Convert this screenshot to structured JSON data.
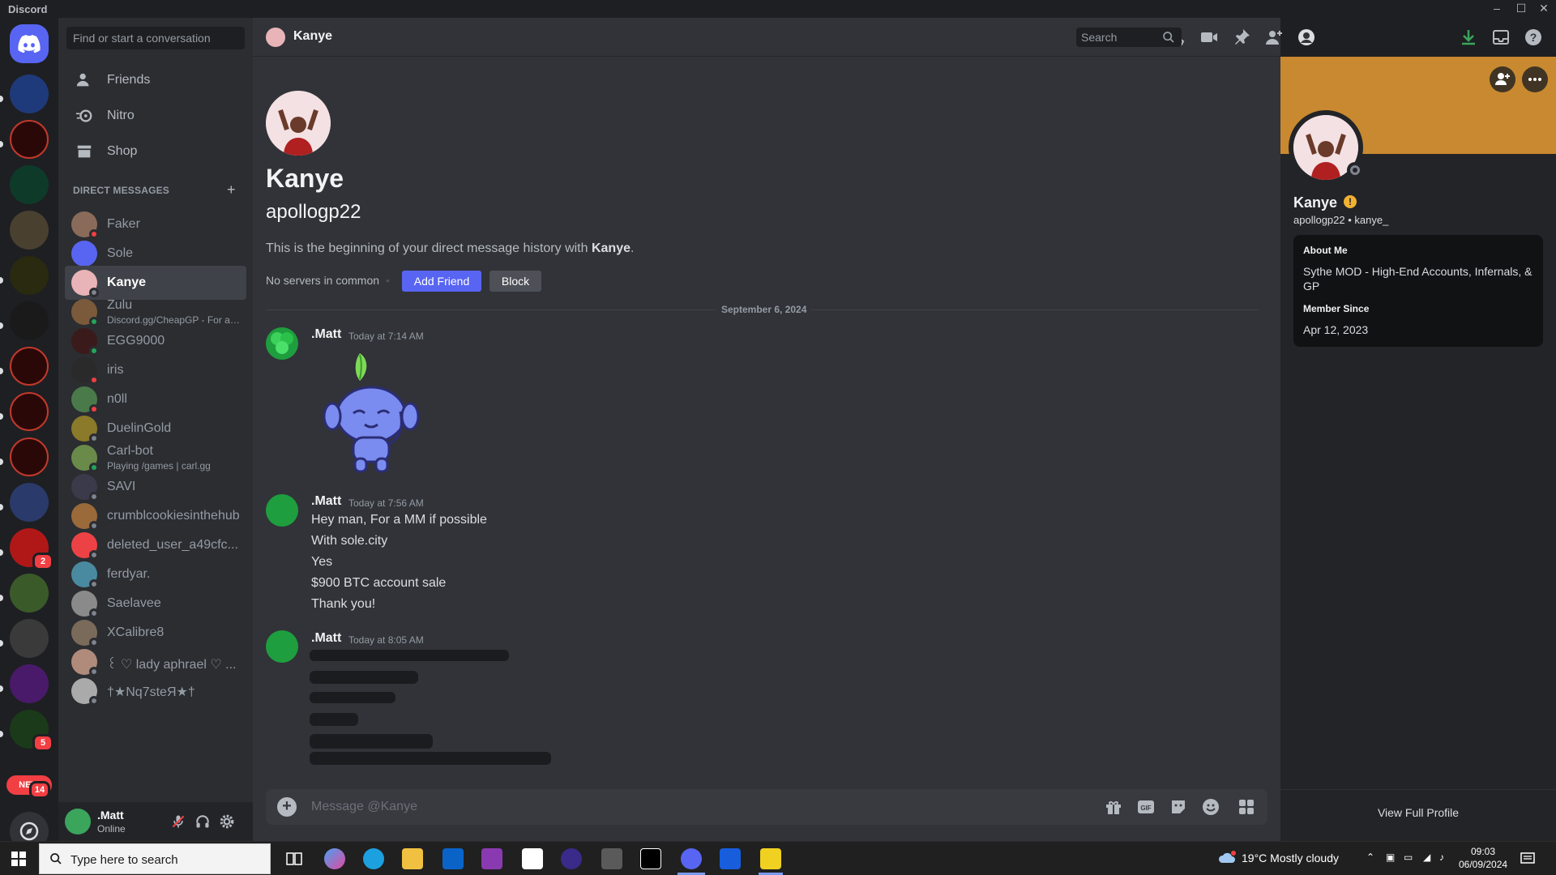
{
  "window": {
    "app_name": "Discord",
    "controls": [
      "–",
      "☐",
      "✕"
    ]
  },
  "search_placeholder": "Find or start a conversation",
  "nav": [
    {
      "label": "Friends",
      "icon": "friends-icon"
    },
    {
      "label": "Nitro",
      "icon": "nitro-icon"
    },
    {
      "label": "Shop",
      "icon": "shop-icon"
    }
  ],
  "dm_header": "DIRECT MESSAGES",
  "dm_add": "+",
  "dms": [
    {
      "name": "Faker",
      "sub": "",
      "status": "dnd",
      "color": "#8a6b5a"
    },
    {
      "name": "Sole",
      "sub": "",
      "status": "none",
      "color": "#5865f2"
    },
    {
      "name": "Kanye",
      "sub": "",
      "status": "offline",
      "color": "#e8b4b8",
      "selected": true
    },
    {
      "name": "Zulu",
      "sub": "Discord.gg/CheapGP - For all ...",
      "status": "online",
      "color": "#7a5a3a"
    },
    {
      "name": "EGG9000",
      "sub": "",
      "status": "online",
      "color": "#3a1a1a"
    },
    {
      "name": "iris",
      "sub": "",
      "status": "dnd",
      "color": "#2a2a2a"
    },
    {
      "name": "n0ll",
      "sub": "",
      "status": "dnd",
      "color": "#4a7a4a"
    },
    {
      "name": "DuelinGold",
      "sub": "",
      "status": "offline",
      "color": "#8a7a2a"
    },
    {
      "name": "Carl-bot",
      "sub": "Playing /games | carl.gg",
      "status": "online",
      "color": "#6a8a4a"
    },
    {
      "name": "SAVI",
      "sub": "",
      "status": "offline",
      "color": "#3a3a4a"
    },
    {
      "name": "crumblcookiesinthehub",
      "sub": "",
      "status": "offline",
      "color": "#9a6a3a"
    },
    {
      "name": "deleted_user_a49cfc...",
      "sub": "",
      "status": "offline",
      "color": "#ed4245"
    },
    {
      "name": "ferdyar.",
      "sub": "",
      "status": "offline",
      "color": "#4a8aa0"
    },
    {
      "name": "Saelavee",
      "sub": "",
      "status": "offline",
      "color": "#8a8a8a"
    },
    {
      "name": "XCalibre8",
      "sub": "",
      "status": "offline",
      "color": "#7a6a5a"
    },
    {
      "name": "꒰ ♡ lady aphrael ♡ ...",
      "sub": "",
      "status": "offline",
      "color": "#b08a7a"
    },
    {
      "name": "†★Nq7steЯ★†",
      "sub": "",
      "status": "offline",
      "color": "#aaaaaa"
    }
  ],
  "user": {
    "name": ".Matt",
    "status": "Online"
  },
  "chat": {
    "recipient": "Kanye",
    "header_search": "Search",
    "intro_name": "Kanye",
    "intro_username": "apollogp22",
    "intro_text_prefix": "This is the beginning of your direct message history with ",
    "intro_text_name": "Kanye",
    "intro_text_suffix": ".",
    "no_servers": "No servers in common",
    "add_friend": "Add Friend",
    "block": "Block",
    "date_divider": "September 6, 2024",
    "messages": [
      {
        "author": ".Matt",
        "time": "Today at 7:14 AM",
        "lines": []
      },
      {
        "author": ".Matt",
        "time": "Today at 7:56 AM",
        "lines": [
          "Hey man, For a MM if possible",
          "With sole.city",
          "Yes",
          "$900 BTC account sale",
          "Thank you!"
        ]
      },
      {
        "author": ".Matt",
        "time": "Today at 8:05 AM",
        "lines": []
      }
    ],
    "composer_placeholder": "Message @Kanye"
  },
  "profile": {
    "name": "Kanye",
    "username": "apollogp22",
    "alt": "kanye_",
    "about_label": "About Me",
    "about": "Sythe MOD - High-End Accounts, Infernals, & GP",
    "member_label": "Member Since",
    "member_since": "Apr 12, 2023",
    "view_full": "View Full Profile",
    "banner_color": "#c88930"
  },
  "taskbar": {
    "search_placeholder": "Type here to search",
    "weather": "19°C  Mostly cloudy",
    "time": "09:03",
    "date": "06/09/2024"
  },
  "server_badges": [
    "2",
    "5",
    "14"
  ],
  "new_label": "NEW"
}
